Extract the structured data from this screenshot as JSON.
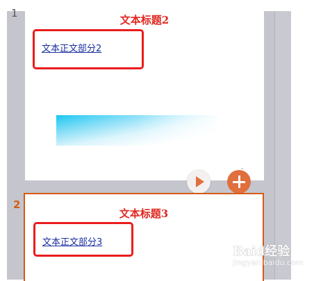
{
  "slides": [
    {
      "number": "1",
      "title": "文本标题2",
      "body": "文本正文部分2"
    },
    {
      "number": "2",
      "title": "文本标题3",
      "body": "文本正文部分3"
    }
  ],
  "watermark": {
    "text": "Baid经验",
    "sub": "jingyan.baidu.com"
  },
  "colors": {
    "title": "#e0261f",
    "body_link": "#1b2fa0",
    "highlight": "#ea1c1c",
    "selected_border": "#d65a13",
    "add_button": "#e06f3d"
  },
  "icons": {
    "play": "play-icon",
    "add": "plus-icon"
  }
}
